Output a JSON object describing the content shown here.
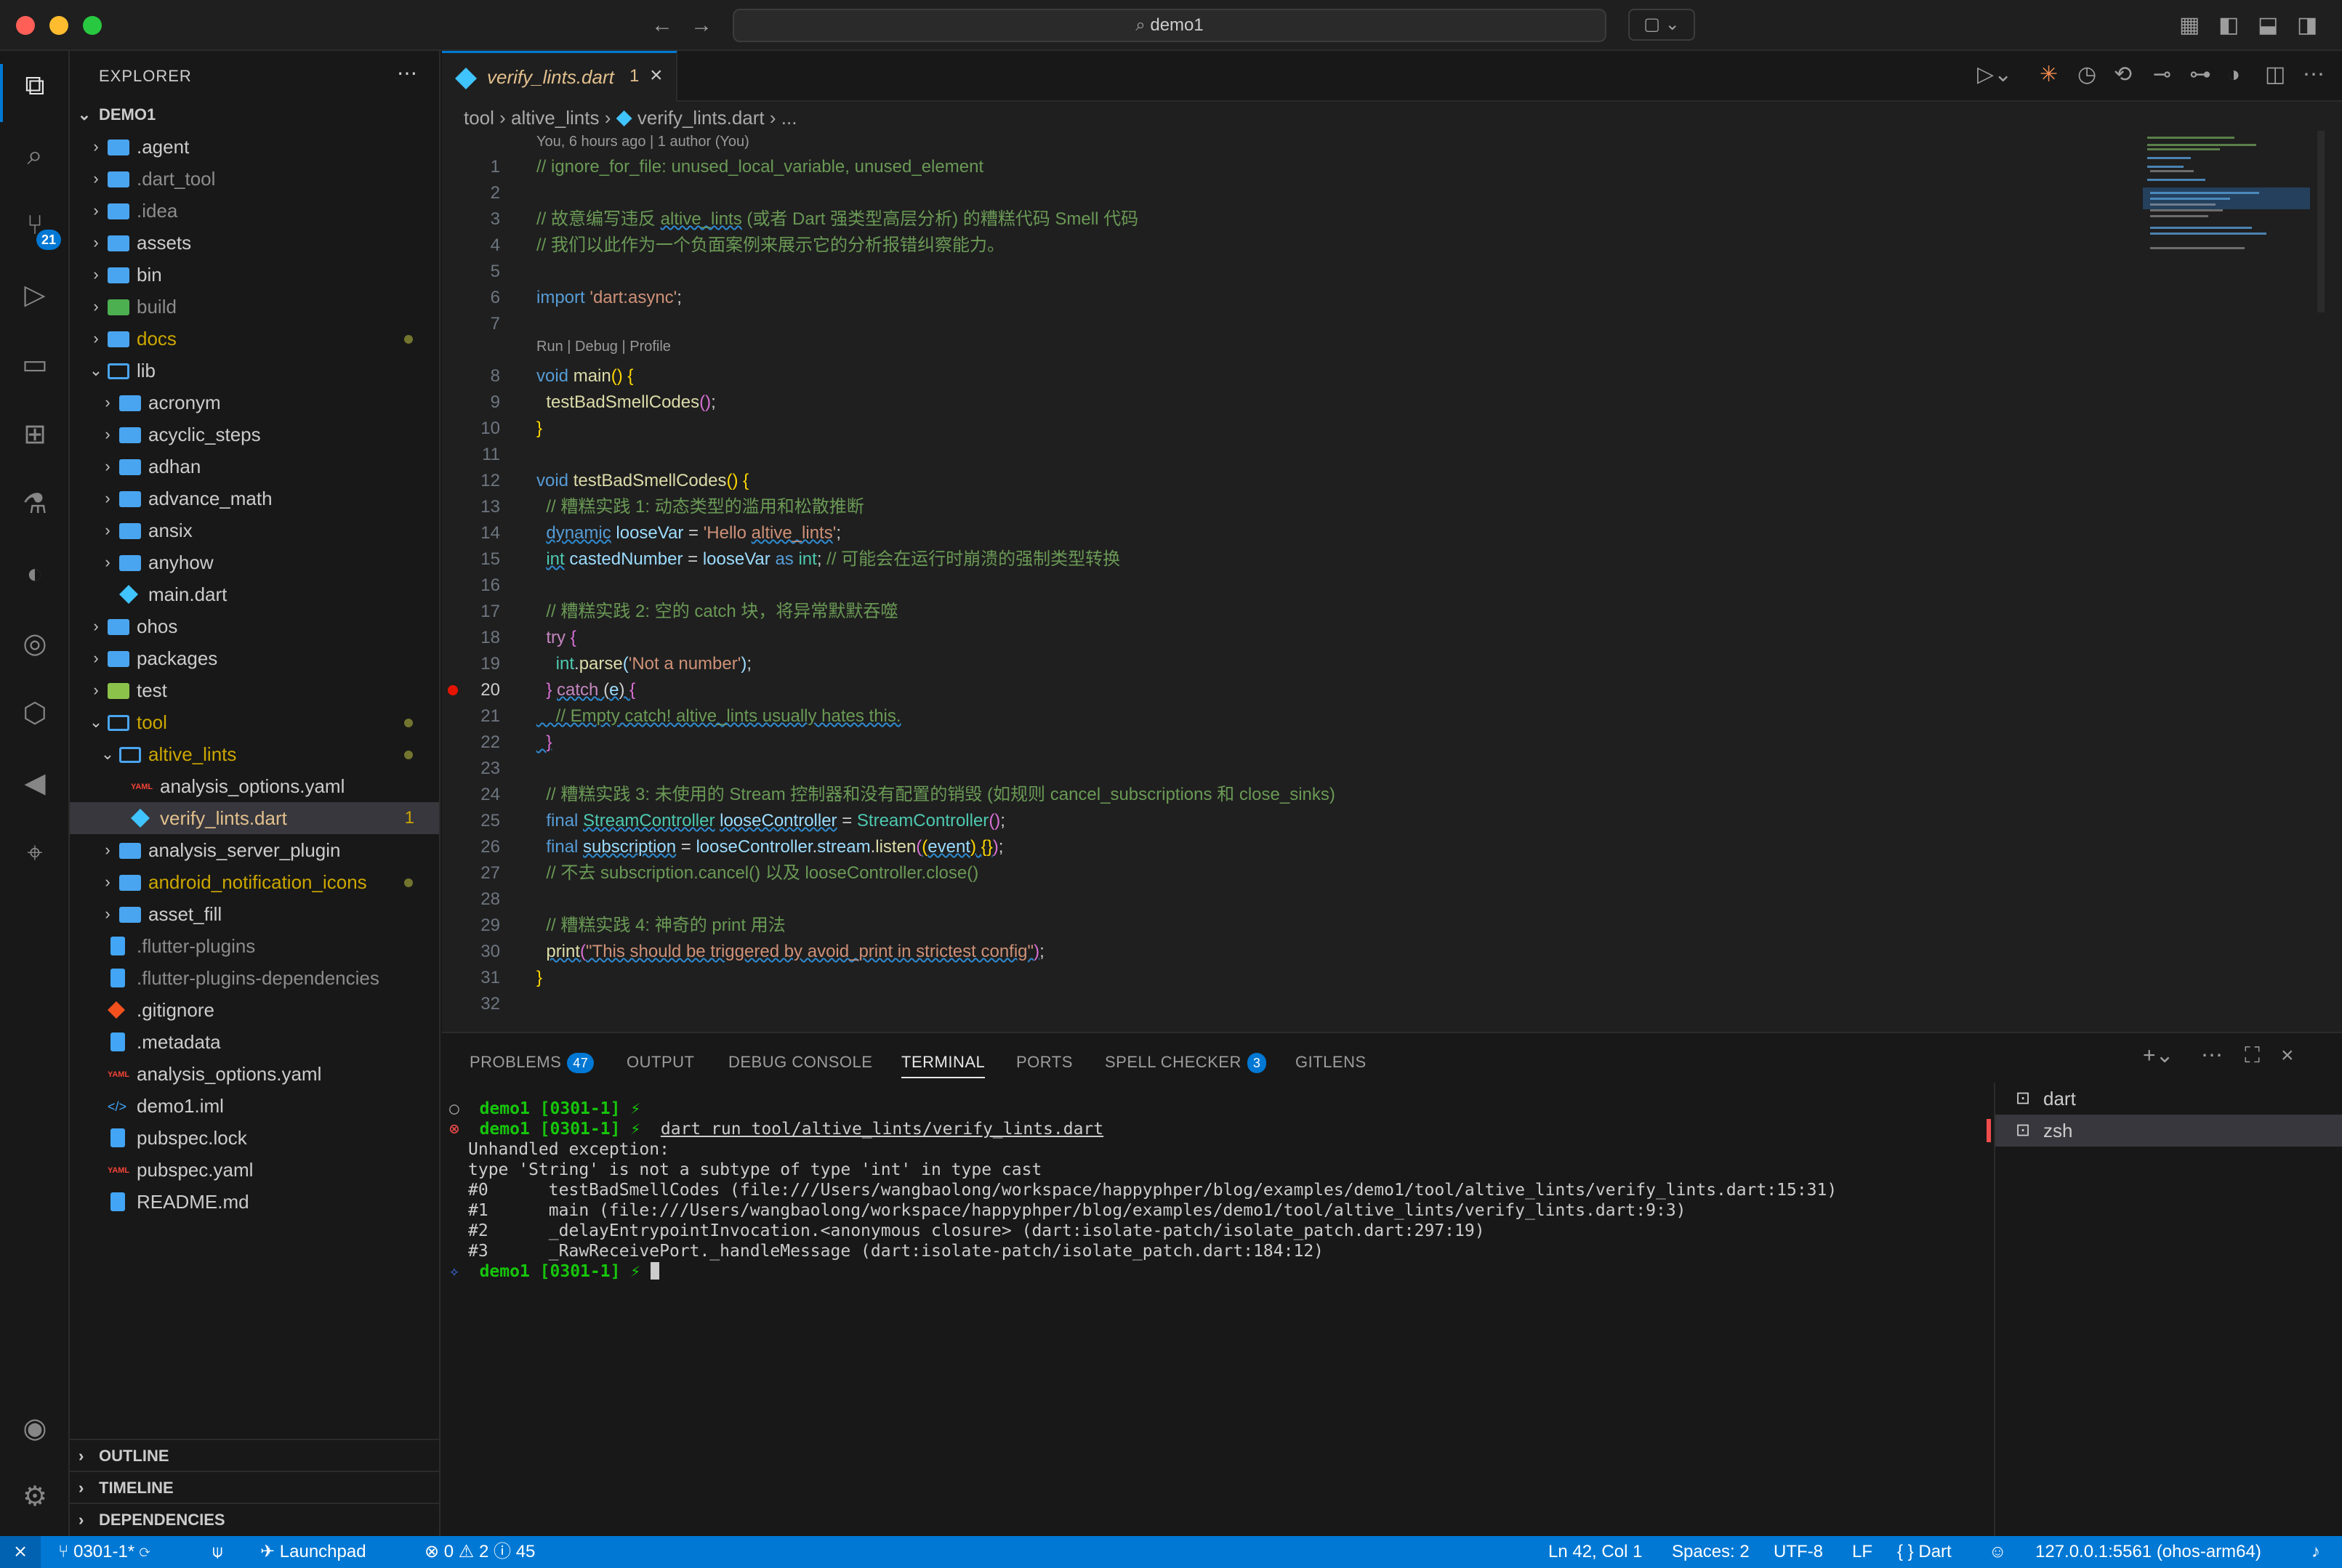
{
  "window": {
    "title": "demo1"
  },
  "colors": {
    "accent": "#0078d4",
    "background": "#1f1f1f",
    "modified": "#cca700",
    "error": "#f14c4c"
  },
  "activity_bar": {
    "items": [
      {
        "name": "explorer-icon",
        "glyph": "⧉"
      },
      {
        "name": "search-icon",
        "glyph": "⌕"
      },
      {
        "name": "source-control-icon",
        "glyph": "⑂",
        "badge": "21"
      },
      {
        "name": "run-debug-icon",
        "glyph": "▷"
      },
      {
        "name": "remote-explorer-icon",
        "glyph": "▭"
      },
      {
        "name": "extensions-icon",
        "glyph": "⊞"
      },
      {
        "name": "testing-icon",
        "glyph": "⚗"
      },
      {
        "name": "gitlens-icon",
        "glyph": "◐"
      },
      {
        "name": "git-graph-icon",
        "glyph": "◎"
      },
      {
        "name": "containers-icon",
        "glyph": "⬡"
      },
      {
        "name": "flutter-icon",
        "glyph": "◀"
      },
      {
        "name": "scan-icon",
        "glyph": "⌖"
      }
    ],
    "accounts_glyph": "◉",
    "settings_glyph": "⚙"
  },
  "explorer": {
    "title": "EXPLORER",
    "root": "DEMO1",
    "items": [
      {
        "label": ".agent",
        "depth": 0,
        "kind": "folder",
        "chev": "›"
      },
      {
        "label": ".dart_tool",
        "depth": 0,
        "kind": "folder",
        "chev": "›",
        "dim": true
      },
      {
        "label": ".idea",
        "depth": 0,
        "kind": "folder",
        "chev": "›",
        "dim": true
      },
      {
        "label": "assets",
        "depth": 0,
        "kind": "folder",
        "chev": "›"
      },
      {
        "label": "bin",
        "depth": 0,
        "kind": "folder",
        "chev": "›"
      },
      {
        "label": "build",
        "depth": 0,
        "kind": "folder-green",
        "chev": "›",
        "dim": true
      },
      {
        "label": "docs",
        "depth": 0,
        "kind": "folder",
        "chev": "›",
        "modified": true
      },
      {
        "label": "lib",
        "depth": 0,
        "kind": "folder-open",
        "chev": "⌄"
      },
      {
        "label": "acronym",
        "depth": 1,
        "kind": "folder",
        "chev": "›"
      },
      {
        "label": "acyclic_steps",
        "depth": 1,
        "kind": "folder",
        "chev": "›"
      },
      {
        "label": "adhan",
        "depth": 1,
        "kind": "folder",
        "chev": "›"
      },
      {
        "label": "advance_math",
        "depth": 1,
        "kind": "folder",
        "chev": "›"
      },
      {
        "label": "ansix",
        "depth": 1,
        "kind": "folder",
        "chev": "›"
      },
      {
        "label": "anyhow",
        "depth": 1,
        "kind": "folder",
        "chev": "›"
      },
      {
        "label": "main.dart",
        "depth": 1,
        "kind": "dart",
        "chev": ""
      },
      {
        "label": "ohos",
        "depth": 0,
        "kind": "folder",
        "chev": "›"
      },
      {
        "label": "packages",
        "depth": 0,
        "kind": "folder",
        "chev": "›"
      },
      {
        "label": "test",
        "depth": 0,
        "kind": "folder-test",
        "chev": "›"
      },
      {
        "label": "tool",
        "depth": 0,
        "kind": "folder-open",
        "chev": "⌄",
        "modified": true
      },
      {
        "label": "altive_lints",
        "depth": 1,
        "kind": "folder-open",
        "chev": "⌄",
        "modified": true
      },
      {
        "label": "analysis_options.yaml",
        "depth": 2,
        "kind": "yaml",
        "chev": ""
      },
      {
        "label": "verify_lints.dart",
        "depth": 2,
        "kind": "dart",
        "chev": "",
        "selected": true,
        "problems": "1"
      },
      {
        "label": "analysis_server_plugin",
        "depth": 1,
        "kind": "folder",
        "chev": "›"
      },
      {
        "label": "android_notification_icons",
        "depth": 1,
        "kind": "folder",
        "chev": "›",
        "modified": true
      },
      {
        "label": "asset_fill",
        "depth": 1,
        "kind": "folder",
        "chev": "›"
      },
      {
        "label": ".flutter-plugins",
        "depth": 0,
        "kind": "file",
        "chev": "",
        "dim": true
      },
      {
        "label": ".flutter-plugins-dependencies",
        "depth": 0,
        "kind": "file",
        "chev": "",
        "dim": true
      },
      {
        "label": ".gitignore",
        "depth": 0,
        "kind": "git",
        "chev": ""
      },
      {
        "label": ".metadata",
        "depth": 0,
        "kind": "file",
        "chev": ""
      },
      {
        "label": "analysis_options.yaml",
        "depth": 0,
        "kind": "yaml",
        "chev": ""
      },
      {
        "label": "demo1.iml",
        "depth": 0,
        "kind": "xml",
        "chev": ""
      },
      {
        "label": "pubspec.lock",
        "depth": 0,
        "kind": "file",
        "chev": ""
      },
      {
        "label": "pubspec.yaml",
        "depth": 0,
        "kind": "yaml",
        "chev": ""
      },
      {
        "label": "README.md",
        "depth": 0,
        "kind": "md",
        "chev": ""
      }
    ],
    "sections": [
      "OUTLINE",
      "TIMELINE",
      "DEPENDENCIES"
    ]
  },
  "editor": {
    "tab": {
      "label": "verify_lints.dart",
      "problems": "1"
    },
    "breadcrumb": [
      "tool",
      "altive_lints",
      "verify_lints.dart",
      "..."
    ],
    "blame": "You, 6 hours ago | 1 author (You)",
    "codelens": "Run | Debug | Profile",
    "current_line": 20
  },
  "panel": {
    "tabs": [
      {
        "label": "PROBLEMS",
        "badge": "47"
      },
      {
        "label": "OUTPUT"
      },
      {
        "label": "DEBUG CONSOLE"
      },
      {
        "label": "TERMINAL",
        "active": true
      },
      {
        "label": "PORTS"
      },
      {
        "label": "SPELL CHECKER",
        "badge": "3"
      },
      {
        "label": "GITLENS"
      }
    ],
    "prompt": "demo1 [0301-1] ⚡",
    "command": "dart run tool/altive_lints/verify_lints.dart",
    "output": [
      "Unhandled exception:",
      "type 'String' is not a subtype of type 'int' in type cast",
      "#0      testBadSmellCodes (file:///Users/wangbaolong/workspace/happyphper/blog/examples/demo1/tool/altive_lints/verify_lints.dart:15:31)",
      "#1      main (file:///Users/wangbaolong/workspace/happyphper/blog/examples/demo1/tool/altive_lints/verify_lints.dart:9:3)",
      "#2      _delayEntrypointInvocation.<anonymous closure> (dart:isolate-patch/isolate_patch.dart:297:19)",
      "#3      _RawReceivePort._handleMessage (dart:isolate-patch/isolate_patch.dart:184:12)"
    ],
    "terminals": [
      "dart",
      "zsh"
    ]
  },
  "statusbar": {
    "remote": "⨯",
    "branch": "0301-1*",
    "launchpad": "Launchpad",
    "errors": "0",
    "warnings": "2",
    "infos": "45",
    "position": "Ln 42, Col 1",
    "spaces": "Spaces: 2",
    "encoding": "UTF-8",
    "eol": "LF",
    "language": "Dart",
    "device": "127.0.0.1:5561 (ohos-arm64)"
  }
}
